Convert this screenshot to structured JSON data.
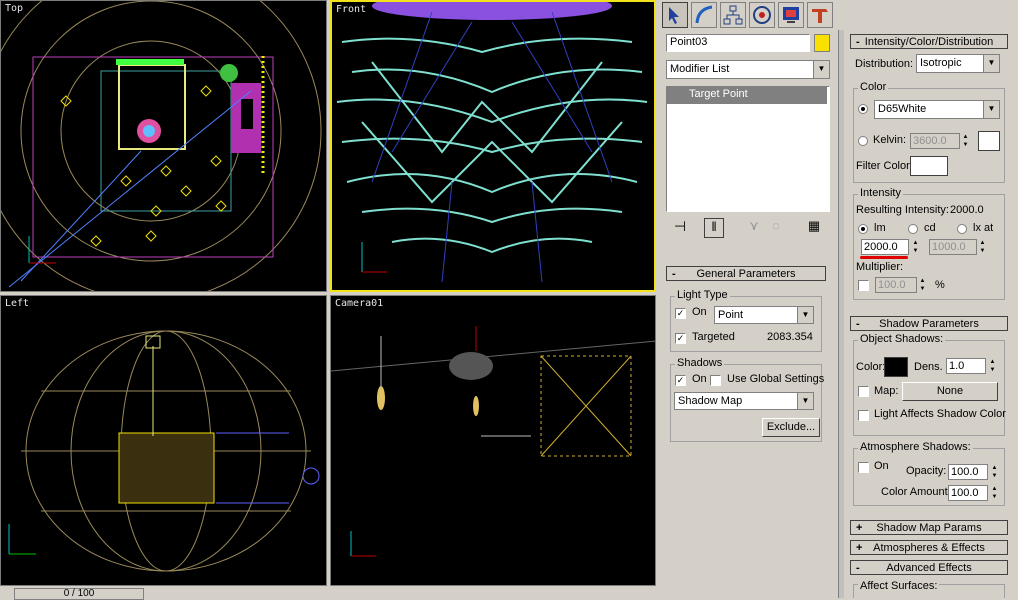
{
  "viewports": {
    "top": {
      "label": "Top"
    },
    "front": {
      "label": "Front"
    },
    "left": {
      "label": "Left"
    },
    "camera": {
      "label": "Camera01"
    }
  },
  "timeline": {
    "label": "0 / 100"
  },
  "command_panel": {
    "tabs": [
      "create-tab",
      "modify-tab",
      "hierarchy-tab",
      "motion-tab",
      "display-tab",
      "utilities-tab"
    ],
    "object_name": "Point03",
    "object_color": "#f8e000",
    "modifier_list": "Modifier List",
    "stack_item": "Target Point"
  },
  "general_params": {
    "title": "General Parameters",
    "light_type_group": "Light Type",
    "on_label": "On",
    "light_type_value": "Point",
    "targeted_label": "Targeted",
    "targeted_distance": "2083.354",
    "shadows_group": "Shadows",
    "shadows_on_label": "On",
    "use_global_label": "Use Global Settings",
    "shadow_type": "Shadow Map",
    "exclude_button": "Exclude..."
  },
  "intensity": {
    "title": "Intensity/Color/Distribution",
    "distribution_label": "Distribution:",
    "distribution_value": "Isotropic",
    "color_group": "Color",
    "color_preset": "D65White",
    "kelvin_label": "Kelvin:",
    "kelvin_value": "3600.0",
    "filter_color_label": "Filter Color:",
    "intensity_group": "Intensity",
    "resulting_label": "Resulting Intensity:",
    "resulting_value": "2000.0",
    "unit_lm": "lm",
    "unit_cd": "cd",
    "unit_lx": "lx at",
    "intensity_value": "2000.0",
    "lx_distance": "1000.0",
    "multiplier_label": "Multiplier:",
    "multiplier_value": "100.0",
    "percent": "%"
  },
  "shadow_params": {
    "title": "Shadow Parameters",
    "object_shadows_group": "Object Shadows:",
    "color_label": "Color:",
    "dens_label": "Dens.",
    "dens_value": "1.0",
    "map_label": "Map:",
    "map_value": "None",
    "light_affects_label": "Light Affects Shadow Color",
    "atmosphere_group": "Atmosphere Shadows:",
    "atm_on_label": "On",
    "opacity_label": "Opacity:",
    "opacity_value": "100.0",
    "color_amount_label": "Color Amount:",
    "color_amount_value": "100.0"
  },
  "rollouts": {
    "shadow_map": "Shadow Map Params",
    "atmospheres": "Atmospheres & Effects",
    "advanced": "Advanced Effects",
    "affect_surfaces": "Affect Surfaces:"
  },
  "colors": {
    "accent_yellow": "#f2e31b",
    "wire_cyan": "#7fe0d0",
    "annotation_red": "#e00000"
  }
}
